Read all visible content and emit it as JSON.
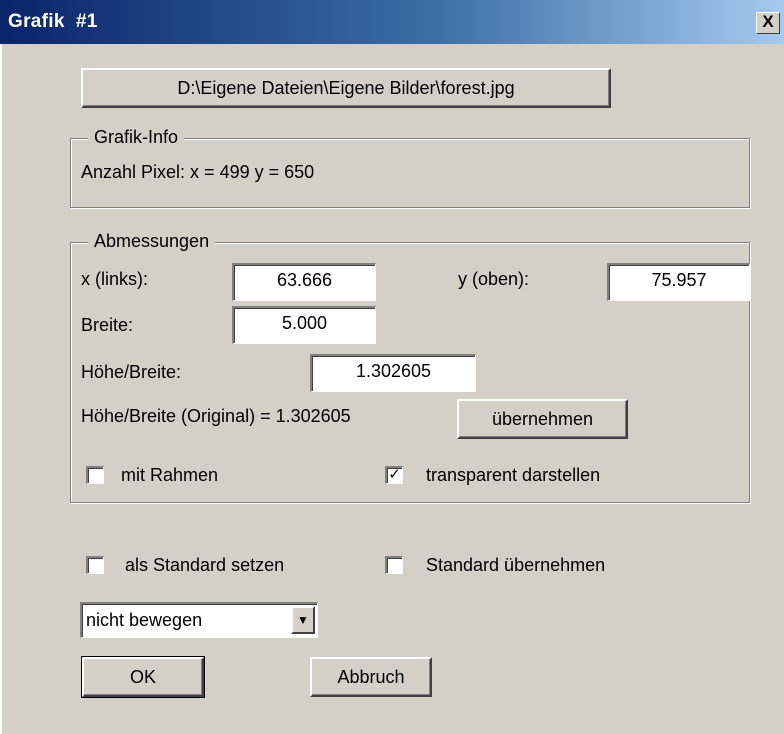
{
  "window": {
    "title": "Grafik  #1",
    "close_label": "X"
  },
  "file_button": {
    "label": "D:\\Eigene Dateien\\Eigene Bilder\\forest.jpg"
  },
  "grafik_info": {
    "legend": "Grafik-Info",
    "pixel_text": "Anzahl Pixel: x = 499  y = 650"
  },
  "abmessungen": {
    "legend": "Abmessungen",
    "x_label": "x (links):",
    "x_value": "63.666",
    "y_label": "y (oben):",
    "y_value": "75.957",
    "breite_label": "Breite:",
    "breite_value": "5.000",
    "hoehe_breite_label": "Höhe/Breite:",
    "hoehe_breite_value": "1.302605",
    "original_text": "Höhe/Breite (Original) = 1.302605",
    "uebernehmen_label": "übernehmen",
    "mit_rahmen": {
      "label": "mit Rahmen",
      "checked": false
    },
    "transparent": {
      "label": "transparent darstellen",
      "checked": true
    }
  },
  "als_standard": {
    "label": "als Standard setzen",
    "checked": false
  },
  "standard_uebernehmen": {
    "label": "Standard übernehmen",
    "checked": false
  },
  "movement_select": {
    "value": "nicht bewegen"
  },
  "ok_button": {
    "label": "OK"
  },
  "cancel_button": {
    "label": "Abbruch"
  }
}
